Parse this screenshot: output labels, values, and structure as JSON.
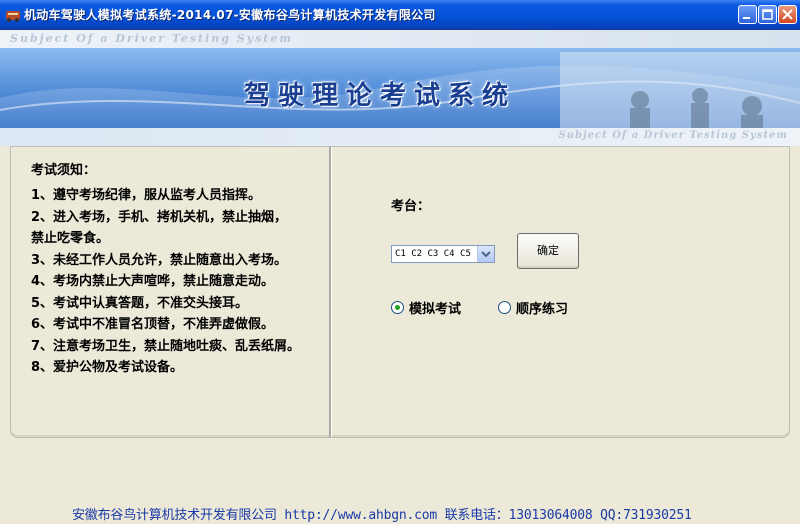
{
  "window": {
    "title": "机动车驾驶人模拟考试系统-2014.07-安徽布谷鸟计算机技术开发有限公司",
    "controls": [
      "minimize",
      "maximize",
      "close"
    ]
  },
  "banner": {
    "subtitle_top": "Subject Of a Driver Testing System",
    "main_title": "驾驶理论考试系统",
    "subtitle_bottom": "Subject Of a Driver Testing System"
  },
  "notice": {
    "heading": "考试须知：",
    "rules": [
      "1、遵守考场纪律，服从监考人员指挥。",
      "2、进入考场，手机、拷机关机，禁止抽烟，",
      "禁止吃零食。",
      "3、未经工作人员允许，禁止随意出入考场。",
      "4、考场内禁止大声喧哗，禁止随意走动。",
      "5、考试中认真答题，不准交头接耳。",
      "6、考试中不准冒名顶替，不准弄虚做假。",
      "7、注意考场卫生，禁止随地吐痰、乱丢纸屑。",
      "8、爱护公物及考试设备。"
    ]
  },
  "exam": {
    "station_label": "考台：",
    "license_select_value": "C1 C2 C3 C4 C5",
    "confirm_label": "确定",
    "mode_simulated": "模拟考试",
    "mode_sequential": "顺序练习",
    "selected_mode": "模拟考试"
  },
  "footer": {
    "text": "安徽布谷鸟计算机技术开发有限公司 http://www.ahbgn.com 联系电话：13013064008 QQ:731930251"
  },
  "colors": {
    "titlebar": "#0653d8",
    "banner_blue": "#2b79d6",
    "footer_text": "#1a3aa8",
    "radio_selected": "#21a121"
  }
}
